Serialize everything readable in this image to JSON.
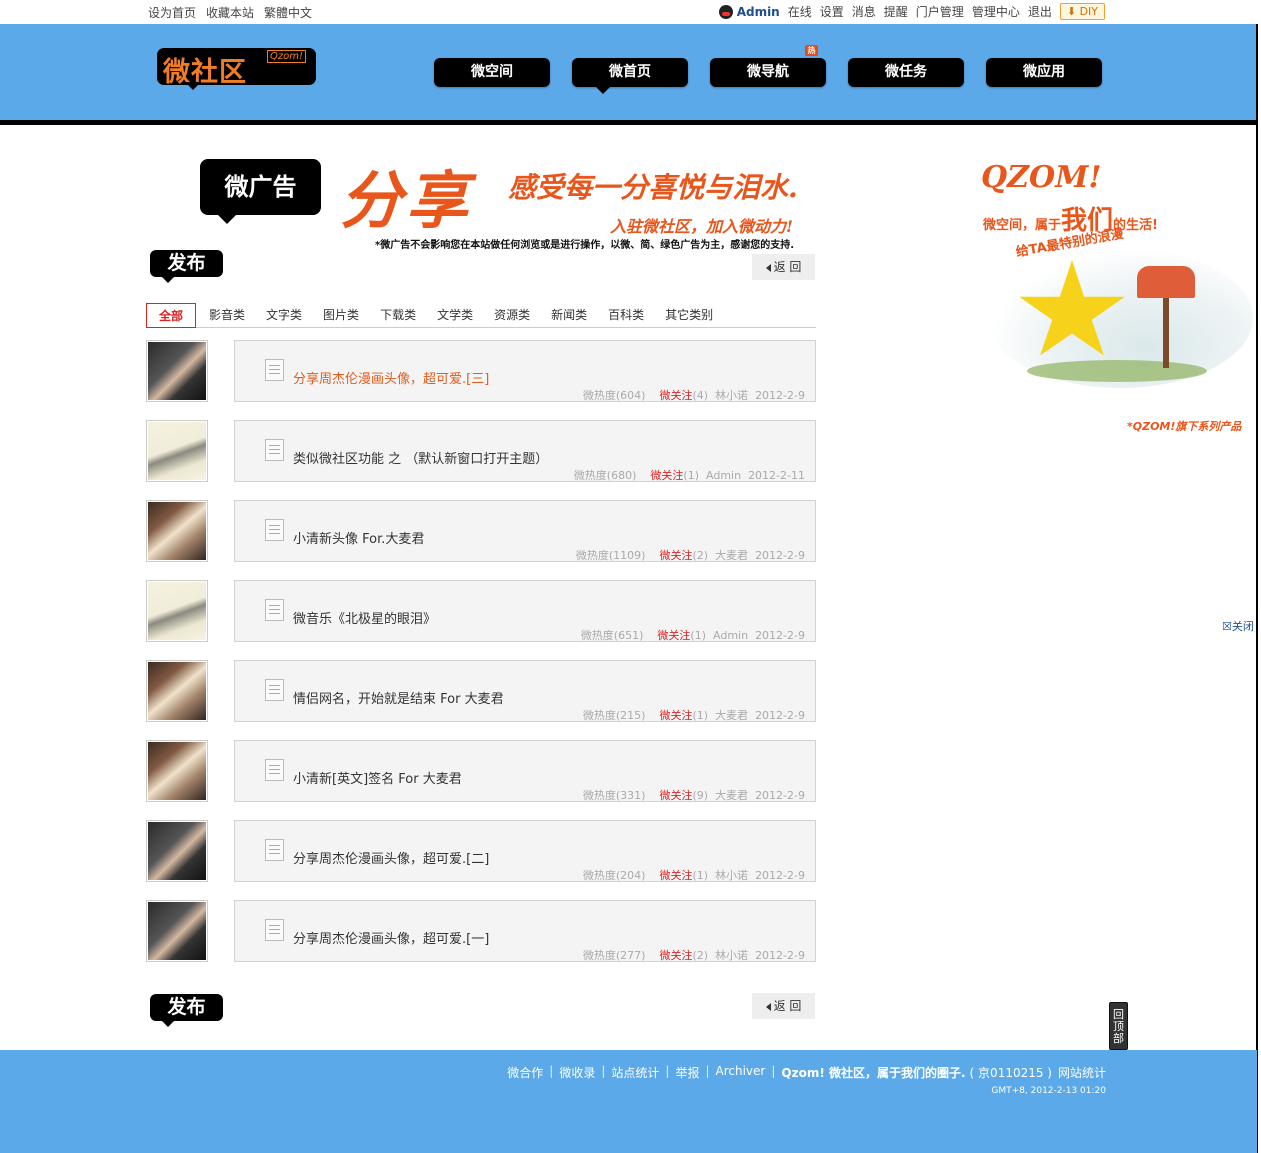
{
  "topbar": {
    "left_links": [
      "设为首页",
      "收藏本站",
      "繁體中文"
    ],
    "user": "Admin",
    "right_links": [
      "在线",
      "设置",
      "消息",
      "提醒",
      "门户管理",
      "管理中心",
      "退出"
    ],
    "diy_label": "DIY"
  },
  "logo": {
    "main": "微社区",
    "sub": "Qzom!"
  },
  "nav": [
    {
      "label": "微空间",
      "active": false,
      "hot": false
    },
    {
      "label": "微首页",
      "active": true,
      "hot": false
    },
    {
      "label": "微导航",
      "active": false,
      "hot": true,
      "badge": "热"
    },
    {
      "label": "微任务",
      "active": false,
      "hot": false
    },
    {
      "label": "微应用",
      "active": false,
      "hot": false
    }
  ],
  "ad": {
    "label": "微广告",
    "big": "分享",
    "slogan1": "感受每一分喜悦与泪水.",
    "slogan2": "入驻微社区，加入微动力!",
    "note": "*微广告不会影响您在本站做任何浏览或是进行操作，以微、简、绿色广告为主，感谢您的支持."
  },
  "publish_label": "发布",
  "return_label": "返 回",
  "categories": [
    {
      "label": "全部",
      "active": true
    },
    {
      "label": "影音类"
    },
    {
      "label": "文字类"
    },
    {
      "label": "图片类"
    },
    {
      "label": "下载类"
    },
    {
      "label": "文学类"
    },
    {
      "label": "资源类"
    },
    {
      "label": "新闻类"
    },
    {
      "label": "百科类"
    },
    {
      "label": "其它类别"
    }
  ],
  "posts": [
    {
      "title": "分享周杰伦漫画头像，超可爱.[三]",
      "highlight": true,
      "heat": "微热度(604)",
      "follow": "微关注",
      "follow_count": "(4)",
      "author": "林小诺",
      "date": "2012-2-9",
      "avatar": "dark"
    },
    {
      "title": "类似微社区功能 之 （默认新窗口打开主题）",
      "highlight": false,
      "heat": "微热度(680)",
      "follow": "微关注",
      "follow_count": "(1)",
      "author": "Admin",
      "date": "2012-2-11",
      "avatar": "light"
    },
    {
      "title": "小清新头像 For.大麦君",
      "highlight": false,
      "heat": "微热度(1109)",
      "follow": "微关注",
      "follow_count": "(2)",
      "author": "大麦君",
      "date": "2012-2-9",
      "avatar": "group"
    },
    {
      "title": "微音乐《北极星的眼泪》",
      "highlight": false,
      "heat": "微热度(651)",
      "follow": "微关注",
      "follow_count": "(1)",
      "author": "Admin",
      "date": "2012-2-9",
      "avatar": "light"
    },
    {
      "title": "情侣网名，开始就是结束 For 大麦君",
      "highlight": false,
      "heat": "微热度(215)",
      "follow": "微关注",
      "follow_count": "(1)",
      "author": "大麦君",
      "date": "2012-2-9",
      "avatar": "group"
    },
    {
      "title": "小清新[英文]签名 For 大麦君",
      "highlight": false,
      "heat": "微热度(331)",
      "follow": "微关注",
      "follow_count": "(9)",
      "author": "大麦君",
      "date": "2012-2-9",
      "avatar": "group"
    },
    {
      "title": "分享周杰伦漫画头像，超可爱.[二]",
      "highlight": false,
      "heat": "微热度(204)",
      "follow": "微关注",
      "follow_count": "(1)",
      "author": "林小诺",
      "date": "2012-2-9",
      "avatar": "dark"
    },
    {
      "title": "分享周杰伦漫画头像，超可爱.[一]",
      "highlight": false,
      "heat": "微热度(277)",
      "follow": "微关注",
      "follow_count": "(2)",
      "author": "林小诺",
      "date": "2012-2-9",
      "avatar": "dark"
    }
  ],
  "side": {
    "title": "QZOM!",
    "sub_prefix": "微空间，属于",
    "sub_bold": "我们",
    "sub_suffix": "的生活!",
    "sub2": "给TA最特别的浪漫",
    "foot": "*QZOM!旗下系列产品",
    "close": "☒关闭"
  },
  "to_top": "回顶部",
  "footer": {
    "links": [
      "微合作",
      "微收录",
      "站点统计",
      "举报",
      "Archiver"
    ],
    "brand": "Qzom! 微社区，属于我们的圈子.",
    "icp": "( 京0110215 )",
    "stats": "网站统计",
    "time": "GMT+8, 2012-2-13 01:20"
  },
  "colors": {
    "header_bg": "#5ca9ea",
    "accent": "#e8561c",
    "follow": "#dd2222"
  }
}
